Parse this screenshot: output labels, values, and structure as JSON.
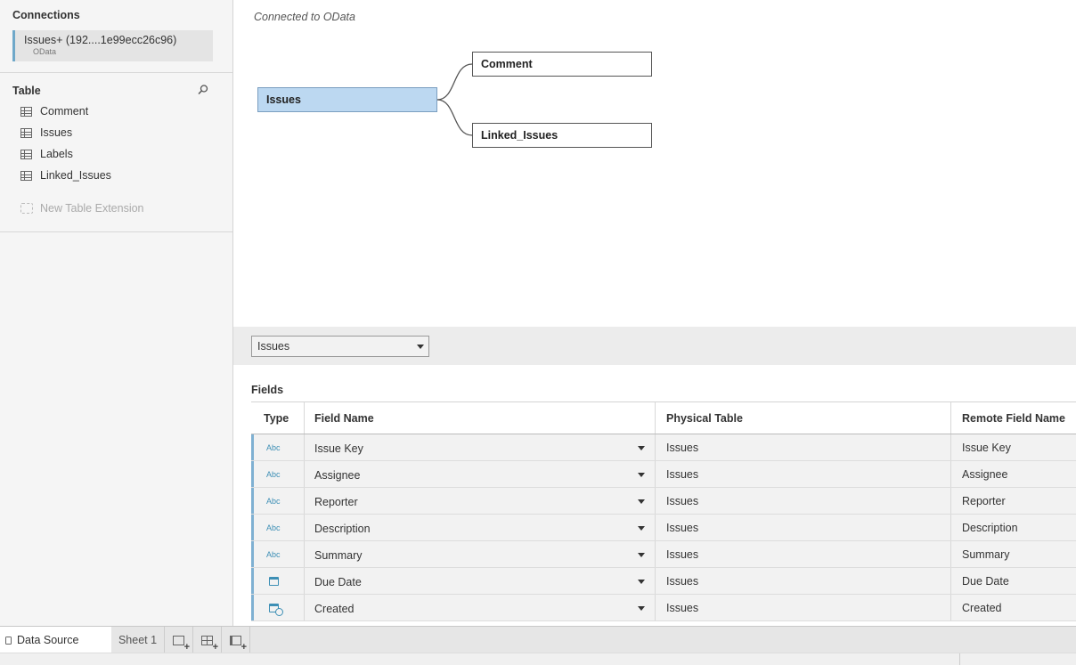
{
  "sidebar": {
    "connections_title": "Connections",
    "connection": {
      "name": "Issues+ (192....1e99ecc26c96)",
      "type": "OData"
    },
    "table_title": "Table",
    "tables": [
      {
        "label": "Comment"
      },
      {
        "label": "Issues"
      },
      {
        "label": "Labels"
      },
      {
        "label": "Linked_Issues"
      }
    ],
    "new_table_extension": "New Table Extension"
  },
  "canvas": {
    "connected_text": "Connected to OData",
    "nodes": {
      "primary": "Issues",
      "related": [
        "Comment",
        "Linked_Issues"
      ]
    }
  },
  "table_selector": {
    "value": "Issues"
  },
  "fields": {
    "title": "Fields",
    "columns": [
      "Type",
      "Field Name",
      "Physical Table",
      "Remote Field Name"
    ],
    "rows": [
      {
        "type": "Abc",
        "type_icon": "string-icon",
        "name": "Issue Key",
        "physical": "Issues",
        "remote": "Issue Key"
      },
      {
        "type": "Abc",
        "type_icon": "string-icon",
        "name": "Assignee",
        "physical": "Issues",
        "remote": "Assignee"
      },
      {
        "type": "Abc",
        "type_icon": "string-icon",
        "name": "Reporter",
        "physical": "Issues",
        "remote": "Reporter"
      },
      {
        "type": "Abc",
        "type_icon": "string-icon",
        "name": "Description",
        "physical": "Issues",
        "remote": "Description"
      },
      {
        "type": "Abc",
        "type_icon": "string-icon",
        "name": "Summary",
        "physical": "Issues",
        "remote": "Summary"
      },
      {
        "type": "",
        "type_icon": "date-icon",
        "name": "Due Date",
        "physical": "Issues",
        "remote": "Due Date"
      },
      {
        "type": "",
        "type_icon": "datetime-icon",
        "name": "Created",
        "physical": "Issues",
        "remote": "Created"
      }
    ]
  },
  "tabs": {
    "data_source": "Data Source",
    "sheet": "Sheet 1"
  },
  "colors": {
    "primary_node": "#bcd8f1",
    "type_accent": "#3d8fb5",
    "row_accent": "#7fb0d2"
  }
}
